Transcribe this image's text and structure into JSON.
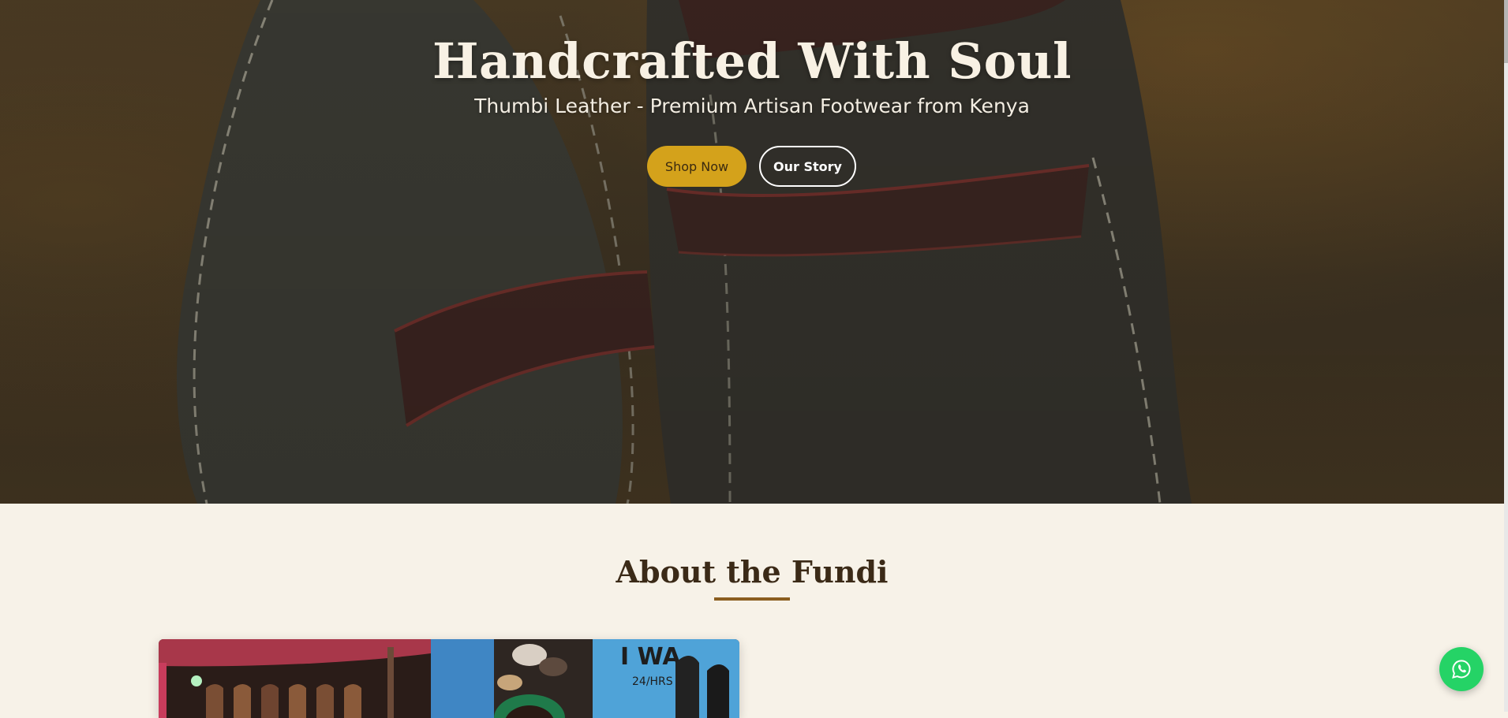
{
  "hero": {
    "title": "Handcrafted With Soul",
    "subtitle": "Thumbi Leather - Premium Artisan Footwear from Kenya",
    "background_image": "leather-sandals-closeup",
    "primary_button_label": "Shop Now",
    "secondary_button_label": "Our Story"
  },
  "about": {
    "title": "About the Fundi",
    "photo": "fundi-market-stall-with-sandals"
  },
  "floating": {
    "whatsapp_icon": "whatsapp-icon"
  },
  "colors": {
    "accent": "#d4a21b",
    "brand_brown": "#8b5e20",
    "heading_dark": "#3b2a17",
    "cream_background": "#f7f2e8",
    "whatsapp_green": "#25d366"
  }
}
